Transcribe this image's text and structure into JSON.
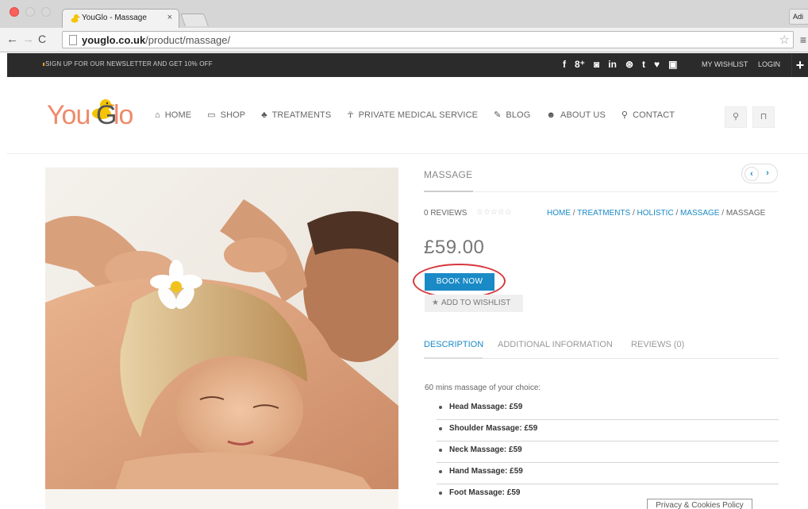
{
  "browser": {
    "tab_title": "YouGlo - Massage",
    "tab_close": "×",
    "profile": "Adi",
    "url_host": "youglo.co.uk",
    "url_path": "/product/massage/",
    "back": "←",
    "forward": "→",
    "reload": "C",
    "star": "☆",
    "menu": "≡"
  },
  "topbar": {
    "promo": "SIGN UP FOR OUR NEWSLETTER AND GET 10% OFF",
    "social": [
      "f",
      "8⁺",
      "◙",
      "in",
      "⊛",
      "t",
      "♥",
      "▣"
    ],
    "wishlist": "MY WISHLIST",
    "login": "LOGIN",
    "plus": "+"
  },
  "header": {
    "logo_you": "You",
    "logo_g": "G",
    "logo_lo": "lo",
    "nav": [
      {
        "icon": "⌂",
        "label": "HOME"
      },
      {
        "icon": "▭",
        "label": "SHOP"
      },
      {
        "icon": "♣",
        "label": "TREATMENTS"
      },
      {
        "icon": "☥",
        "label": "PRIVATE MEDICAL SERVICE"
      },
      {
        "icon": "✎",
        "label": "BLOG"
      },
      {
        "icon": "☻",
        "label": "ABOUT US"
      },
      {
        "icon": "⚲",
        "label": "CONTACT"
      }
    ],
    "search_icon": "⚲",
    "cart_icon": "⊓"
  },
  "product": {
    "title": "MASSAGE",
    "prev": "‹",
    "next": "›",
    "reviews": "0 REVIEWS",
    "stars": "☆☆☆☆☆",
    "breadcrumb": {
      "home": "HOME",
      "treatments": "TREATMENTS",
      "holistic": "HOLISTIC",
      "massage_link": "MASSAGE",
      "current": "MASSAGE",
      "sep": " / "
    },
    "price": "£59.00",
    "book_now": "BOOK NOW",
    "wishlist_icon": "★",
    "add_to_wishlist": "ADD TO WISHLIST",
    "tabs": [
      "DESCRIPTION",
      "ADDITIONAL INFORMATION",
      "REVIEWS (0)"
    ],
    "description_intro": "60 mins massage of your choice:",
    "items": [
      "Head Massage:  £59",
      "Shoulder Massage:  £59",
      "Neck Massage:  £59",
      "Hand Massage:  £59",
      "Foot Massage:  £59"
    ]
  },
  "cookie_label": "Privacy & Cookies Policy"
}
